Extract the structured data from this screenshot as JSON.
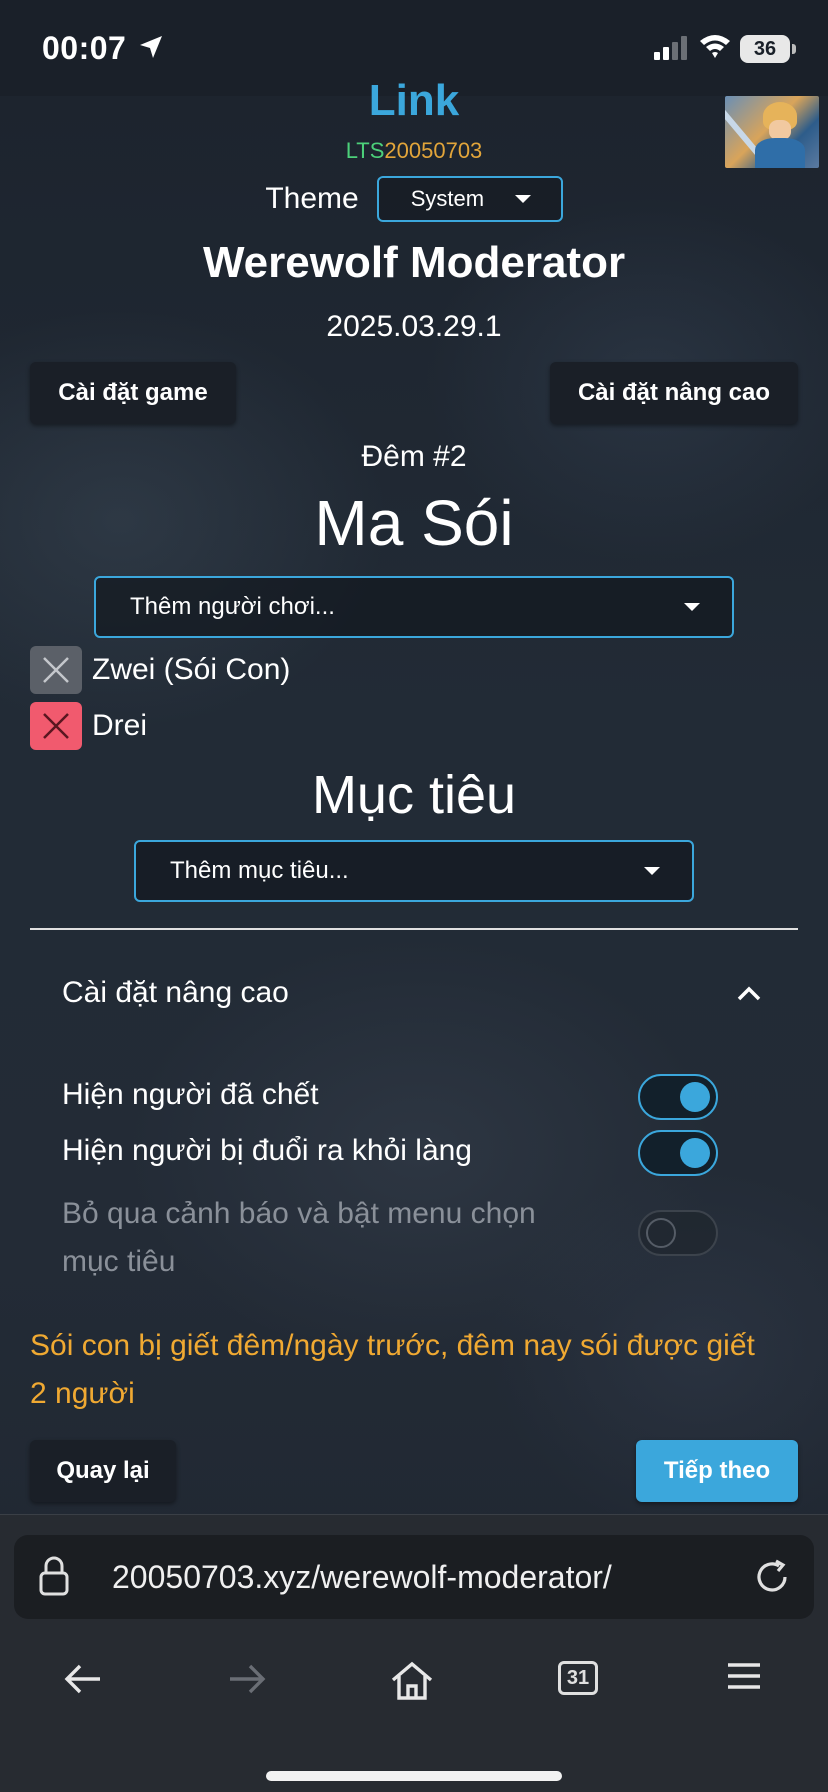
{
  "status_bar": {
    "time": "00:07",
    "battery": "36",
    "icons": [
      "location-arrow-icon",
      "signal-icon",
      "wifi-icon",
      "battery-icon"
    ]
  },
  "header": {
    "link_title": "Link",
    "version_prefix": "LTS",
    "version_number": "20050703",
    "theme_label": "Theme",
    "theme_value": "System",
    "app_title": "Werewolf Moderator",
    "app_version": "2025.03.29.1"
  },
  "toolbar": {
    "game_settings": "Cài đặt game",
    "advanced_settings": "Cài đặt nâng cao"
  },
  "phase": {
    "night_label": "Đêm #2",
    "role_title": "Ma Sói",
    "add_player_placeholder": "Thêm người chơi...",
    "players": [
      {
        "name": "Zwei (Sói Con)",
        "remove_style": "grey"
      },
      {
        "name": "Drei",
        "remove_style": "red"
      }
    ],
    "target_title": "Mục tiêu",
    "add_target_placeholder": "Thêm mục tiêu..."
  },
  "advanced": {
    "header": "Cài đặt nâng cao",
    "expanded": true,
    "toggles": [
      {
        "label": "Hiện người đã chết",
        "on": true,
        "enabled": true
      },
      {
        "label": "Hiện người bị đuổi ra khỏi làng",
        "on": true,
        "enabled": true
      },
      {
        "label": "Bỏ qua cảnh báo và bật menu chọn mục tiêu",
        "on": false,
        "enabled": false
      }
    ]
  },
  "warning": "Sói con bị giết đêm/ngày trước, đêm nay sói được giết 2 người",
  "footer_buttons": {
    "back": "Quay lại",
    "next": "Tiếp theo"
  },
  "browser": {
    "url": "20050703.xyz/werewolf-moderator/",
    "tab_count": "31"
  },
  "colors": {
    "accent": "#3ba7dc",
    "warning": "#f0a932",
    "danger": "#f15a6e",
    "lts_green": "#4cd07a"
  }
}
